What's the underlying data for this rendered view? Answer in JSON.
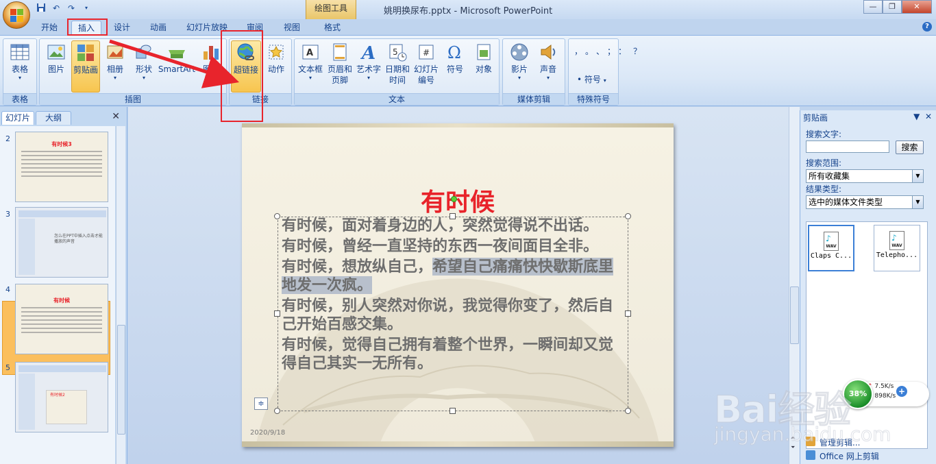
{
  "window": {
    "title": "姚明换尿布.pptx - Microsoft PowerPoint",
    "context_tab": "绘图工具",
    "controls": [
      "minimize-icon",
      "restore-icon",
      "close-icon"
    ]
  },
  "quick_access": [
    "save-icon",
    "undo-icon",
    "redo-icon"
  ],
  "tabs": [
    {
      "label": "开始",
      "active": false
    },
    {
      "label": "插入",
      "active": true
    },
    {
      "label": "设计",
      "active": false
    },
    {
      "label": "动画",
      "active": false
    },
    {
      "label": "幻灯片放映",
      "active": false
    },
    {
      "label": "审阅",
      "active": false
    },
    {
      "label": "视图",
      "active": false
    },
    {
      "label": "格式",
      "active": false
    }
  ],
  "ribbon": {
    "groups": {
      "tables": {
        "label": "表格",
        "buttons": [
          {
            "label": "表格",
            "icon": "table-icon"
          }
        ]
      },
      "illustrations": {
        "label": "插图",
        "buttons": [
          {
            "label": "图片",
            "icon": "picture-icon"
          },
          {
            "label": "剪贴画",
            "icon": "clipart-icon"
          },
          {
            "label": "相册",
            "icon": "photo-album-icon"
          },
          {
            "label": "形状",
            "icon": "shapes-icon"
          },
          {
            "label": "SmartArt",
            "icon": "smartart-icon"
          },
          {
            "label": "图表",
            "icon": "chart-icon"
          }
        ]
      },
      "links": {
        "label": "链接",
        "buttons": [
          {
            "label": "超链接",
            "icon": "hyperlink-icon"
          },
          {
            "label": "动作",
            "icon": "action-icon"
          }
        ]
      },
      "text": {
        "label": "文本",
        "buttons": [
          {
            "label": "文本框",
            "icon": "textbox-icon"
          },
          {
            "label": "页眉和",
            "label2": "页脚",
            "icon": "header-footer-icon"
          },
          {
            "label": "艺术字",
            "icon": "wordart-icon"
          },
          {
            "label": "日期和",
            "label2": "时间",
            "icon": "date-time-icon"
          },
          {
            "label": "幻灯片",
            "label2": "编号",
            "icon": "slide-number-icon"
          },
          {
            "label": "符号",
            "icon": "symbol-icon"
          },
          {
            "label": "对象",
            "icon": "object-icon"
          }
        ]
      },
      "media": {
        "label": "媒体剪辑",
        "buttons": [
          {
            "label": "影片",
            "icon": "movie-icon"
          },
          {
            "label": "声音",
            "icon": "sound-icon"
          }
        ]
      },
      "special_symbols": {
        "label": "特殊符号",
        "button": "符号",
        "glyphs": "，。、；：？"
      }
    }
  },
  "left_panel": {
    "tabs": [
      "幻灯片",
      "大纲"
    ],
    "thumbnails": [
      {
        "number": "2",
        "title": "有时候3"
      },
      {
        "number": "3",
        "title": "怎么在PPT中插入点击才能播放的声音"
      },
      {
        "number": "4",
        "title": "有时候",
        "selected": true
      },
      {
        "number": "5",
        "title": "有时候2"
      }
    ]
  },
  "slide": {
    "title": "有时候",
    "paragraphs": [
      {
        "text": "有时候，面对着身边的人，突然觉得说不出话。"
      },
      {
        "text": "有时候，曾经一直坚持的东西一夜间面目全非。"
      },
      {
        "pre": "有时候，想放纵自己，",
        "highlight": "希望自己痛痛快快歇斯底里地发一次疯。"
      },
      {
        "text": "有时候，别人突然对你说，我觉得你变了，然后自己开始百感交集。"
      },
      {
        "text": "有时候，觉得自己拥有着整个世界，一瞬间却又觉得自己其实一无所有。"
      }
    ],
    "date": "2020/9/18"
  },
  "clipart_panel": {
    "title": "剪贴画",
    "search_label": "搜索文字:",
    "search_value": "",
    "search_button": "搜索",
    "scope_label": "搜索范围:",
    "scope_value": "所有收藏集",
    "type_label": "结果类型:",
    "type_value": "选中的媒体文件类型",
    "results": [
      {
        "caption": "Claps C...",
        "icon": "wav-file-icon"
      },
      {
        "caption": "Telepho...",
        "icon": "wav-file-icon"
      }
    ],
    "links": [
      "管理剪辑...",
      "Office 网上剪辑"
    ]
  },
  "net_widget": {
    "percent": "38%",
    "up": "7.5K/s",
    "down": "898K/s"
  },
  "watermark": {
    "brand": "Bai经验",
    "site": "jingyan.baidu.com"
  },
  "colors": {
    "accent_red": "#e8242c",
    "title_red": "#e8232a",
    "ribbon_blue": "#15428b"
  }
}
